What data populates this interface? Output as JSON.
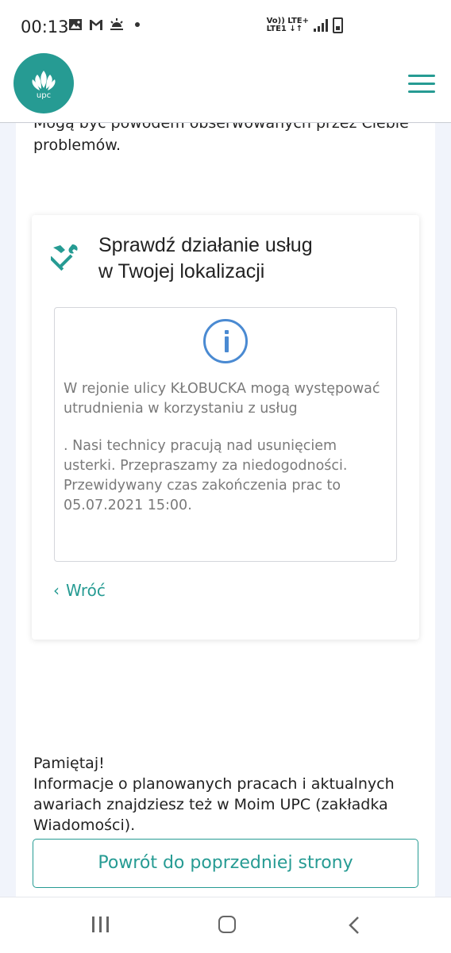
{
  "status_bar": {
    "time": "00:13",
    "network": [
      "Vo)) LTE+",
      "LTE1 ↓↑"
    ],
    "notification_icons": [
      "image-icon",
      "gmail-icon",
      "weather-icon",
      "dot-icon"
    ],
    "system_icons": [
      "signal-icon",
      "battery-icon"
    ]
  },
  "header": {
    "logo_text": "upc",
    "menu_icon": "hamburger-icon",
    "brand_color": "#269b93"
  },
  "intro": {
    "text": "Mogą być powodem obserwowanych przez Ciebie problemów."
  },
  "card": {
    "icon": "tools-icon",
    "title_line1": "Sprawdź działanie usług",
    "title_line2": "w Twojej lokalizacji",
    "info": {
      "icon": "info-icon",
      "paragraph1": "W rejonie ulicy KŁOBUCKA mogą występować utrudnienia w korzystaniu z usług",
      "paragraph2": ". Nasi technicy pracują nad usunięciem usterki. Przepraszamy za niedogodności. Przewidywany czas zakończenia prac to 05.07.2021 15:00."
    },
    "back_chevron": "‹",
    "back_label": "Wróć"
  },
  "reminder": {
    "heading": "Pamiętaj!",
    "text": "Informacje o planowanych pracach i aktualnych awariach znajdziesz też w Moim UPC (zakładka Wiadomości)."
  },
  "return_button": {
    "label": "Powrót do poprzedniej strony"
  },
  "nav_bar": {
    "buttons": [
      "recent-apps-icon",
      "home-icon",
      "back-icon"
    ]
  }
}
